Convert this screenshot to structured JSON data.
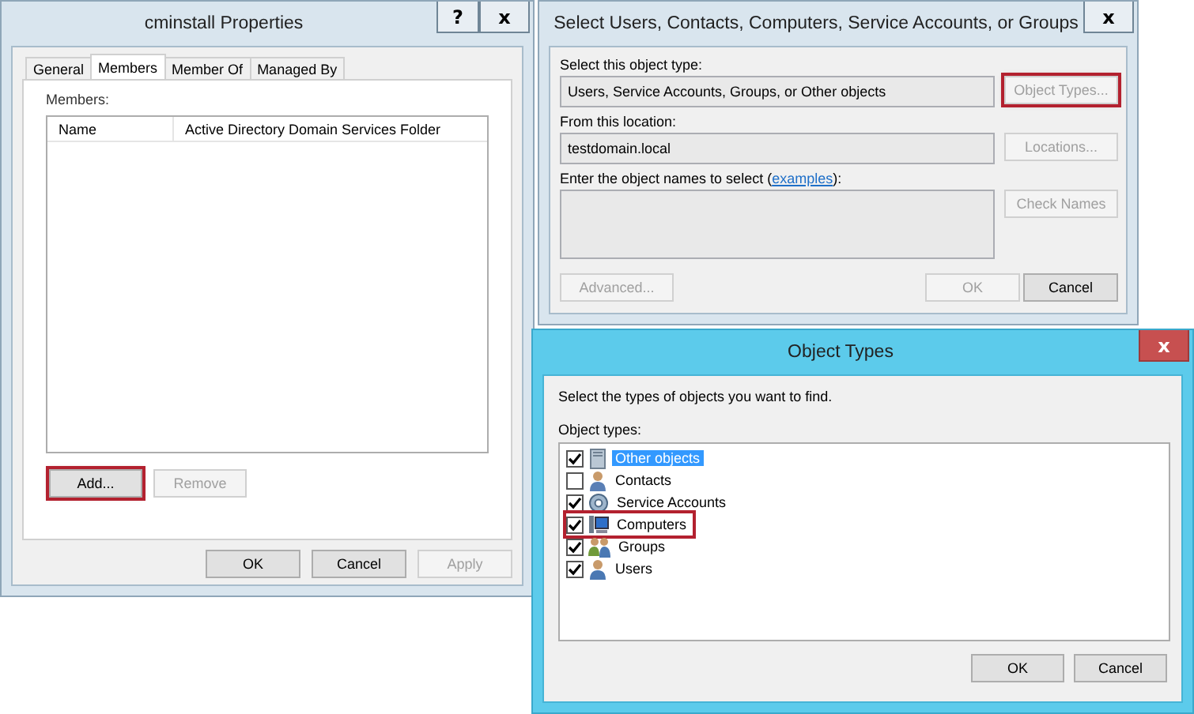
{
  "properties_window": {
    "title": "cminstall Properties",
    "active": false,
    "title_buttons": [
      {
        "label": "?",
        "kind": "help"
      },
      {
        "label": "x",
        "kind": "close"
      }
    ],
    "tabs": [
      {
        "label": "General",
        "selected": false
      },
      {
        "label": "Members",
        "selected": true
      },
      {
        "label": "Member Of",
        "selected": false
      },
      {
        "label": "Managed By",
        "selected": false
      }
    ],
    "members_label": "Members:",
    "columns": [
      "Name",
      "Active Directory Domain Services Folder"
    ],
    "list_buttons": [
      {
        "label": "Add...",
        "disabled": false,
        "highlighted": true
      },
      {
        "label": "Remove",
        "disabled": true,
        "highlighted": false
      }
    ],
    "footer_buttons": [
      {
        "label": "OK",
        "disabled": false,
        "highlighted": false
      },
      {
        "label": "Cancel",
        "disabled": false,
        "highlighted": false
      },
      {
        "label": "Apply",
        "disabled": true,
        "highlighted": false
      }
    ]
  },
  "select_window": {
    "title": "Select Users, Contacts, Computers, Service Accounts, or Groups",
    "active": false,
    "title_buttons": [
      {
        "label": "x",
        "kind": "close"
      }
    ],
    "object_type_label": "Select this object type:",
    "object_type_value": "Users, Service Accounts, Groups, or Other objects",
    "object_types_button": {
      "label": "Object Types...",
      "disabled": true,
      "highlighted": true
    },
    "location_label": "From this location:",
    "location_value": "testdomain.local",
    "locations_button": {
      "label": "Locations...",
      "disabled": true,
      "highlighted": false
    },
    "names_label_before": "Enter the object names to select (",
    "names_link": "examples",
    "names_label_after": "):",
    "check_names_button": {
      "label": "Check Names",
      "disabled": true,
      "highlighted": false
    },
    "advanced_button": {
      "label": "Advanced...",
      "disabled": true,
      "highlighted": false
    },
    "footer_buttons": [
      {
        "label": "OK",
        "disabled": true,
        "highlighted": false
      },
      {
        "label": "Cancel",
        "disabled": false,
        "highlighted": false
      }
    ]
  },
  "object_types_window": {
    "title": "Object Types",
    "active": true,
    "title_buttons": [
      {
        "label": "x",
        "kind": "close"
      }
    ],
    "instruction": "Select the types of objects you want to find.",
    "list_label": "Object types:",
    "object_types": [
      {
        "label": "Other objects",
        "kind": "other",
        "checked": true,
        "selected": true,
        "highlighted": false
      },
      {
        "label": "Contacts",
        "kind": "contact",
        "checked": false,
        "selected": false,
        "highlighted": false
      },
      {
        "label": "Service Accounts",
        "kind": "service",
        "checked": true,
        "selected": false,
        "highlighted": false
      },
      {
        "label": "Computers",
        "kind": "computer",
        "checked": true,
        "selected": false,
        "highlighted": true
      },
      {
        "label": "Groups",
        "kind": "group",
        "checked": true,
        "selected": false,
        "highlighted": false
      },
      {
        "label": "Users",
        "kind": "user",
        "checked": true,
        "selected": false,
        "highlighted": false
      }
    ],
    "footer_buttons": [
      {
        "label": "OK",
        "disabled": false,
        "highlighted": false
      },
      {
        "label": "Cancel",
        "disabled": false,
        "highlighted": false
      }
    ]
  }
}
